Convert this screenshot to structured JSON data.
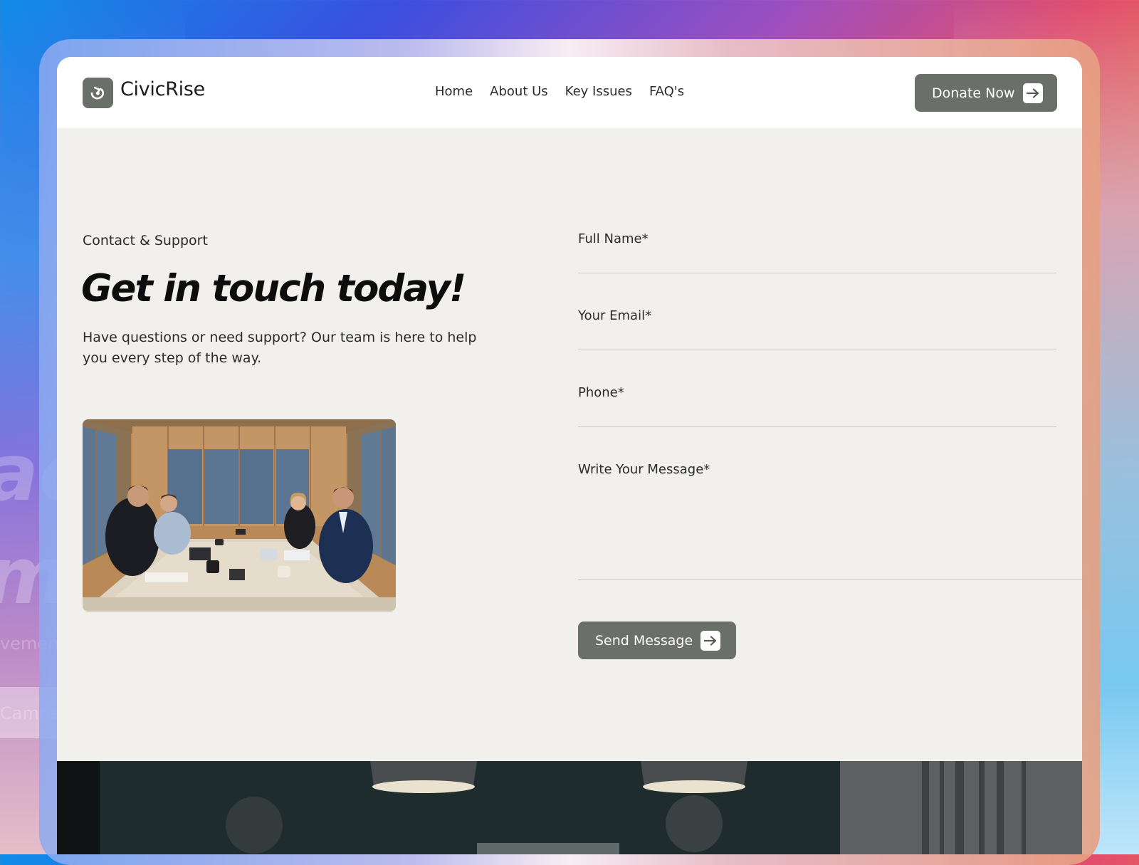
{
  "brand": {
    "name": "CivicRise",
    "logo_icon": "swirl-icon"
  },
  "nav": {
    "items": [
      {
        "label": "Home"
      },
      {
        "label": "About Us"
      },
      {
        "label": "Key Issues"
      },
      {
        "label": "FAQ's"
      }
    ],
    "donate_label": "Donate Now",
    "donate_icon": "arrow-right-icon"
  },
  "hero": {
    "eyebrow": "Contact & Support",
    "headline": "Get in touch today!",
    "lead": "Have questions or need support? Our team is here to help you every step of the way."
  },
  "form": {
    "full_name_label": "Full Name*",
    "email_label": "Your Email*",
    "phone_label": "Phone*",
    "message_label": "Write Your Message*",
    "submit_label": "Send Message",
    "submit_icon": "arrow-right-icon"
  },
  "background": {
    "ghost_words": [
      "ac",
      "me",
      "vemen",
      "Campa"
    ]
  },
  "colors": {
    "accent": "#6b6f69",
    "page_bg": "#f1f0ed",
    "text": "#2b2b2b"
  }
}
